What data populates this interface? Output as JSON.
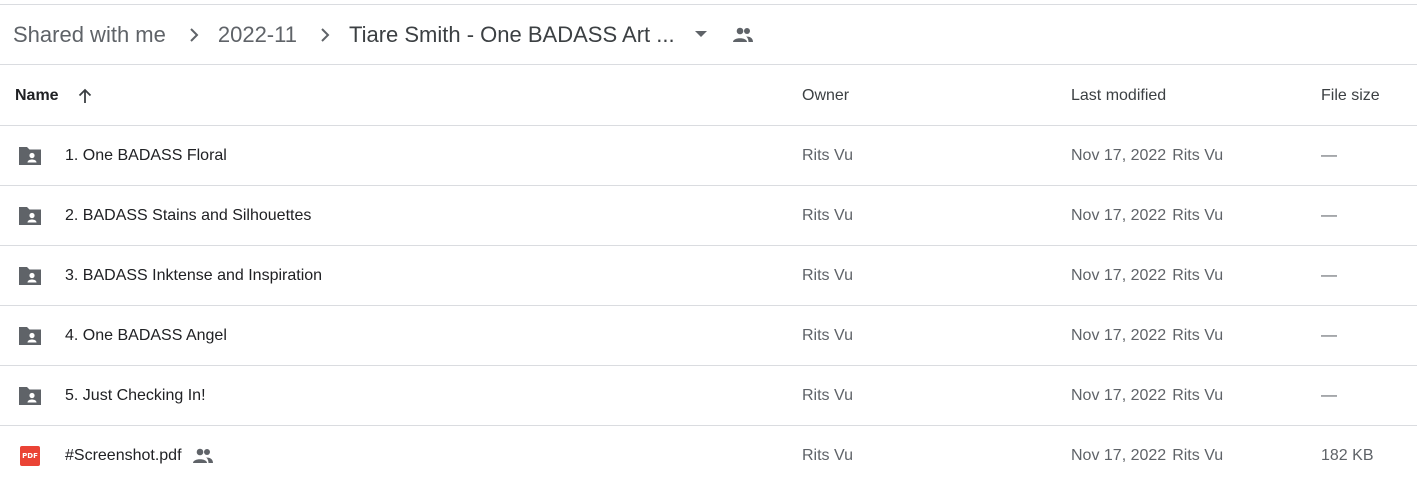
{
  "breadcrumb": {
    "items": [
      {
        "label": "Shared with me"
      },
      {
        "label": "2022-11"
      },
      {
        "label": "Tiare Smith - One BADASS Art ..."
      }
    ]
  },
  "columns": {
    "name": "Name",
    "owner": "Owner",
    "last_modified": "Last modified",
    "file_size": "File size"
  },
  "icons": {
    "folder_color": "#5f6368",
    "pdf_color": "#ea4335",
    "pdf_badge_text": "PDF"
  },
  "rows": [
    {
      "type": "shared-folder",
      "name": "1. One BADASS Floral",
      "owner": "Rits Vu",
      "modified": "Nov 17, 2022",
      "modified_by": "Rits Vu",
      "size": "—"
    },
    {
      "type": "shared-folder",
      "name": "2. BADASS Stains and Silhouettes",
      "owner": "Rits Vu",
      "modified": "Nov 17, 2022",
      "modified_by": "Rits Vu",
      "size": "—"
    },
    {
      "type": "shared-folder",
      "name": "3. BADASS Inktense and Inspiration",
      "owner": "Rits Vu",
      "modified": "Nov 17, 2022",
      "modified_by": "Rits Vu",
      "size": "—"
    },
    {
      "type": "shared-folder",
      "name": "4. One BADASS Angel",
      "owner": "Rits Vu",
      "modified": "Nov 17, 2022",
      "modified_by": "Rits Vu",
      "size": "—"
    },
    {
      "type": "shared-folder",
      "name": "5. Just Checking In!",
      "owner": "Rits Vu",
      "modified": "Nov 17, 2022",
      "modified_by": "Rits Vu",
      "size": "—"
    },
    {
      "type": "pdf",
      "name": "#Screenshot.pdf",
      "owner": "Rits Vu",
      "modified": "Nov 17, 2022",
      "modified_by": "Rits Vu",
      "size": "182 KB"
    }
  ]
}
